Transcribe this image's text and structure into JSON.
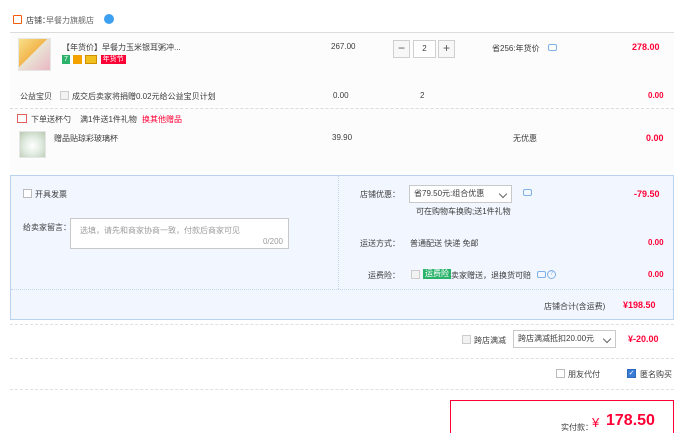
{
  "shop": {
    "label": "店铺：",
    "name": "早餐力旗舰店"
  },
  "item": {
    "title": "【年货价】早餐力玉米银耳粥冲...",
    "price": "267.00",
    "qty": "2",
    "discount": "省256:年货价",
    "subtotal": "278.00",
    "tags": [
      "7",
      "",
      "",
      "年货节"
    ]
  },
  "charity": {
    "label": "公益宝贝",
    "desc": "成交后卖家将捐赠0.02元给公益宝贝计划",
    "price": "0.00",
    "qty": "2",
    "subtotal": "0.00"
  },
  "gift": {
    "header": "下单送杯勺",
    "promo": "满1件送1件礼物",
    "change_link": "换其他赠品",
    "name": "赠品贴琼彩玻璃杯",
    "price": "39.90",
    "discount": "无优惠",
    "subtotal": "0.00"
  },
  "invoice": {
    "label": "开具发票"
  },
  "message": {
    "label": "给卖家留言：",
    "placeholder": "选填，请先和商家协商一致，付款后商家可见",
    "count": "0/200"
  },
  "store_discount": {
    "label": "店铺优惠：",
    "value": "省79.50元:组合优惠",
    "hint": "可在购物车换购;送1件礼物",
    "amount": "-79.50"
  },
  "delivery": {
    "label": "运送方式：",
    "value": "普通配送 快递 免邮",
    "amount": "0.00"
  },
  "insurance": {
    "label": "运费险：",
    "badge": "运费险",
    "desc": "卖家赠送，退换货可赔",
    "amount": "0.00"
  },
  "store_total": {
    "label": "店铺合计(含运费)",
    "amount": "¥198.50"
  },
  "cross_store": {
    "label": "跨店满减",
    "value": "跨店满减抵扣20.00元",
    "amount": "¥-20.00"
  },
  "options": {
    "friend_pay": "朋友代付",
    "anonymous": "匿名购买"
  },
  "pay": {
    "label": "实付款：",
    "currency": "¥",
    "amount": "178.50"
  },
  "colors": {
    "accent": "#ff0036",
    "panel": "#f2f7ff",
    "border": "#b9d3ef",
    "checked": "#3a7bd5"
  }
}
